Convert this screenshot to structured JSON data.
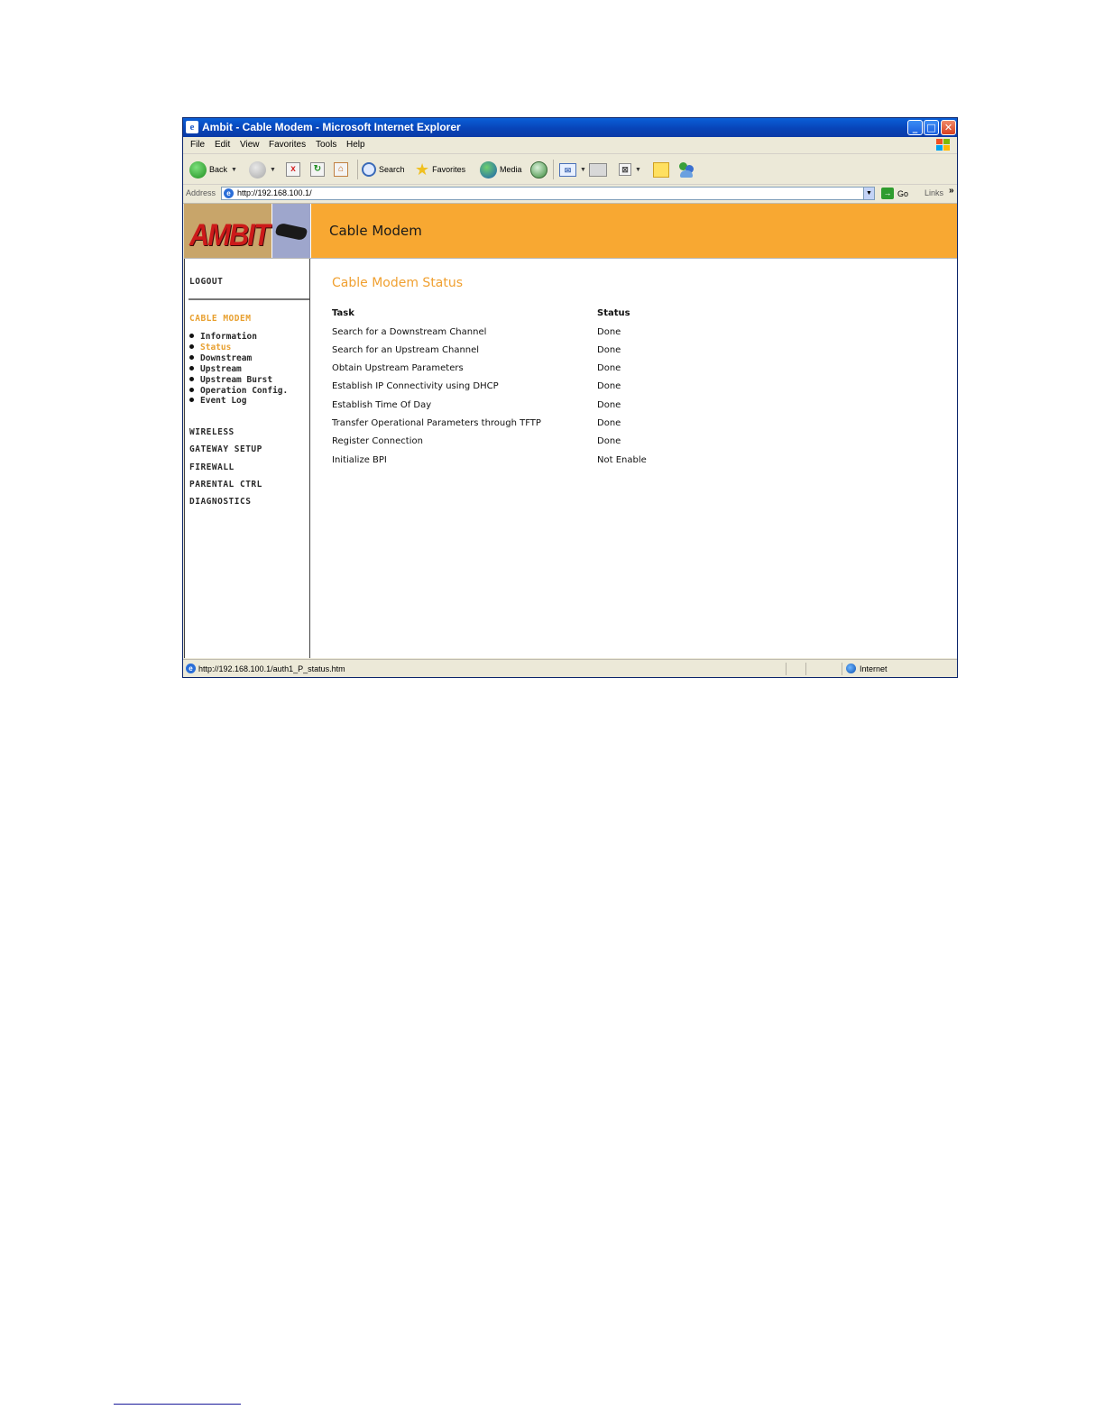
{
  "window": {
    "title": "Ambit - Cable Modem - Microsoft Internet Explorer",
    "controls": {
      "minimize": "_",
      "maximize": "□",
      "close": "✕"
    }
  },
  "menubar": {
    "items": [
      "File",
      "Edit",
      "View",
      "Favorites",
      "Tools",
      "Help"
    ]
  },
  "toolbar": {
    "back_label": "Back",
    "search_label": "Search",
    "favorites_label": "Favorites",
    "media_label": "Media"
  },
  "addressbar": {
    "label": "Address",
    "url": "http://192.168.100.1/",
    "go_label": "Go",
    "links_label": "Links"
  },
  "banner": {
    "logo_text": "AMBIT",
    "title": "Cable Modem"
  },
  "sidebar": {
    "logout": "LOGOUT",
    "section": "CABLE MODEM",
    "subitems": [
      "Information",
      "Status",
      "Downstream",
      "Upstream",
      "Upstream Burst",
      "Operation Config.",
      "Event Log"
    ],
    "active_subitem": "Status",
    "items": [
      "WIRELESS",
      "GATEWAY SETUP",
      "FIREWALL",
      "PARENTAL CTRL",
      "DIAGNOSTICS"
    ]
  },
  "content": {
    "title": "Cable Modem Status",
    "columns": [
      "Task",
      "Status"
    ],
    "rows": [
      {
        "task": "Search for a Downstream Channel",
        "status": "Done"
      },
      {
        "task": "Search for an Upstream Channel",
        "status": "Done"
      },
      {
        "task": "Obtain Upstream Parameters",
        "status": "Done"
      },
      {
        "task": "Establish IP Connectivity using DHCP",
        "status": "Done"
      },
      {
        "task": "Establish Time Of Day",
        "status": "Done"
      },
      {
        "task": "Transfer Operational Parameters through TFTP",
        "status": "Done"
      },
      {
        "task": "Register Connection",
        "status": "Done"
      },
      {
        "task": "Initialize BPI",
        "status": "Not Enable"
      }
    ]
  },
  "statusbar": {
    "url": "http://192.168.100.1/auth1_P_status.htm",
    "zone": "Internet"
  },
  "colors": {
    "accent_orange": "#f8a832",
    "section_orange": "#e8a030",
    "titlebar_blue": "#0a5fd8"
  }
}
